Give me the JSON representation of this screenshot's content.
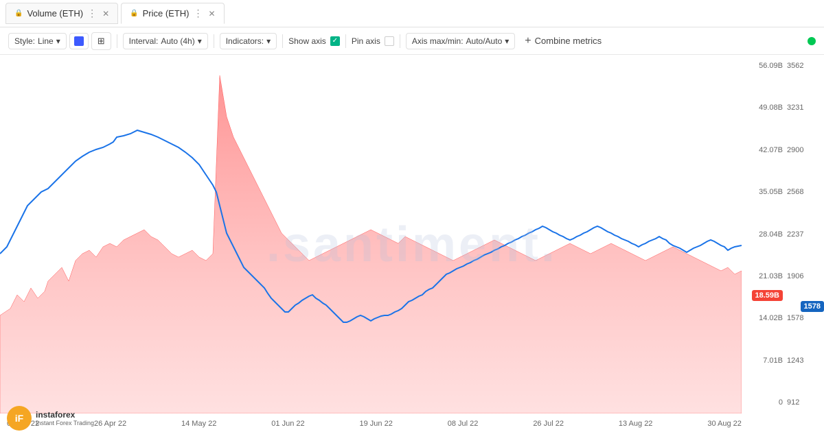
{
  "tabs": [
    {
      "id": "volume",
      "label": "Volume (ETH)",
      "active": false
    },
    {
      "id": "price",
      "label": "Price (ETH)",
      "active": true
    }
  ],
  "toolbar": {
    "style_label": "Style:",
    "style_value": "Line",
    "interval_label": "Interval:",
    "interval_value": "Auto (4h)",
    "indicators_label": "Indicators:",
    "show_axis_label": "Show axis",
    "pin_axis_label": "Pin axis",
    "axis_maxmin_label": "Axis max/min:",
    "axis_maxmin_value": "Auto/Auto",
    "combine_label": "Combine metrics"
  },
  "y_axis_left": [
    "56.09B",
    "49.08B",
    "42.07B",
    "35.05B",
    "28.04B",
    "21.03B",
    "14.02B",
    "7.01B",
    "0"
  ],
  "y_axis_right": [
    "3562",
    "3231",
    "2900",
    "2568",
    "2237",
    "1906",
    "1578",
    "1243",
    "912"
  ],
  "x_axis": [
    "08 Apr 22",
    "26 Apr 22",
    "14 May 22",
    "01 Jun 22",
    "19 Jun 22",
    "08 Jul 22",
    "26 Jul 22",
    "13 Aug 22",
    "30 Aug 22"
  ],
  "current_values": {
    "left_label": "18.59B",
    "right_label": "1578"
  },
  "watermark": ".santiment.",
  "logo": {
    "icon_text": "iF",
    "name": "instaforex",
    "tagline": "Instant Forex Trading"
  },
  "status_dot_color": "#00c853"
}
